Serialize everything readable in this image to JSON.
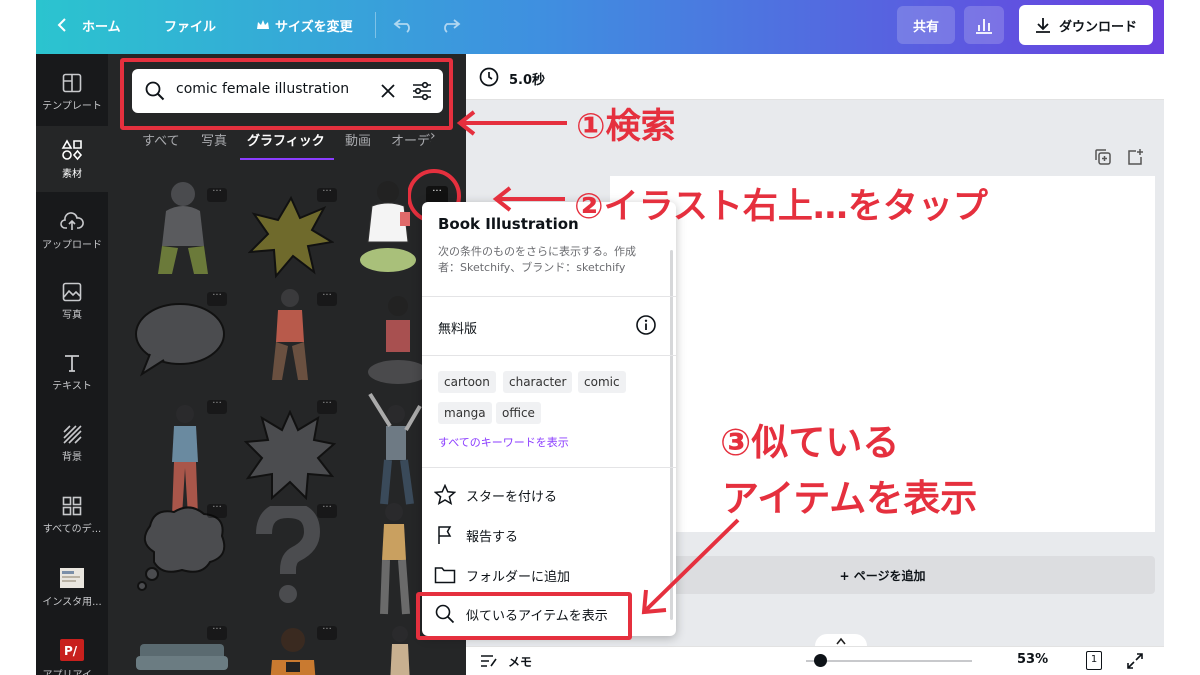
{
  "topbar": {
    "home": "ホーム",
    "file": "ファイル",
    "resize": "サイズを変更",
    "share": "共有",
    "download": "ダウンロード"
  },
  "rail": {
    "items": [
      {
        "label": "テンプレート",
        "icon": "template-icon"
      },
      {
        "label": "素材",
        "icon": "elements-icon"
      },
      {
        "label": "アップロード",
        "icon": "upload-icon"
      },
      {
        "label": "写真",
        "icon": "photo-icon"
      },
      {
        "label": "テキスト",
        "icon": "text-icon"
      },
      {
        "label": "背景",
        "icon": "background-icon"
      },
      {
        "label": "すべてのデ...",
        "icon": "apps-icon"
      },
      {
        "label": "インスタ用...",
        "icon": "folder-thumb-icon"
      },
      {
        "label": "アプリアイ...",
        "icon": "app-icon"
      }
    ]
  },
  "search": {
    "query": "comic female illustration"
  },
  "tabs": [
    "すべて",
    "写真",
    "グラフィック",
    "動画",
    "オーディ"
  ],
  "timer": "5.0秒",
  "canvas": {
    "add_page": "+ ページを追加",
    "notes": "メモ",
    "zoom": "53%",
    "page_count": "1"
  },
  "menu": {
    "title": "Book Illustration",
    "description": "次の条件のものをさらに表示する。作成者：Sketchify、ブランド：sketchify",
    "license": "無料版",
    "tags": [
      "cartoon",
      "character",
      "comic",
      "manga",
      "office"
    ],
    "see_all_keywords": "すべてのキーワードを表示",
    "star": "スターを付ける",
    "report": "報告する",
    "add_folder": "フォルダーに追加",
    "similar": "似ているアイテムを表示"
  },
  "annotations": {
    "step1": "①検索",
    "step2": "②イラスト右上…をタップ",
    "step3_line1": "③似ている",
    "step3_line2": "アイテムを表示"
  },
  "colors": {
    "accent": "#8b3dff",
    "annotation": "#e5303e",
    "panel": "#252627",
    "rail": "#18191b"
  }
}
